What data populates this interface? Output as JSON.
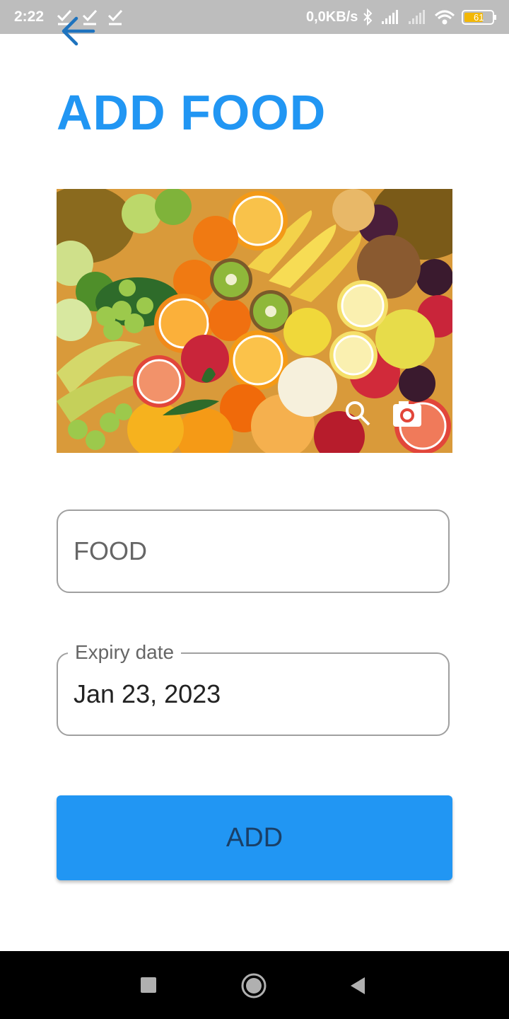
{
  "status_bar": {
    "time": "2:22",
    "net_speed": "0,0KB/s",
    "battery": "61",
    "icons": [
      "check-icon",
      "check-icon",
      "check-icon",
      "bluetooth-icon",
      "signal-icon",
      "signal-icon",
      "wifi-icon",
      "battery-icon"
    ]
  },
  "header": {
    "back_icon": "arrow-left-icon",
    "title": "ADD FOOD"
  },
  "image": {
    "subject": "assorted fruit",
    "overlay_icons": [
      "search-icon",
      "camera-icon"
    ]
  },
  "form": {
    "food_placeholder": "FOOD",
    "expiry_label": "Expiry date",
    "expiry_value": "Jan 23, 2023"
  },
  "actions": {
    "add_label": "ADD"
  },
  "nav_bar": {
    "icons": [
      "recents-icon",
      "home-icon",
      "back-icon"
    ]
  },
  "colors": {
    "accent": "#2196f3",
    "status_bar": "#bdbdbd",
    "nav_bar": "#000000"
  }
}
